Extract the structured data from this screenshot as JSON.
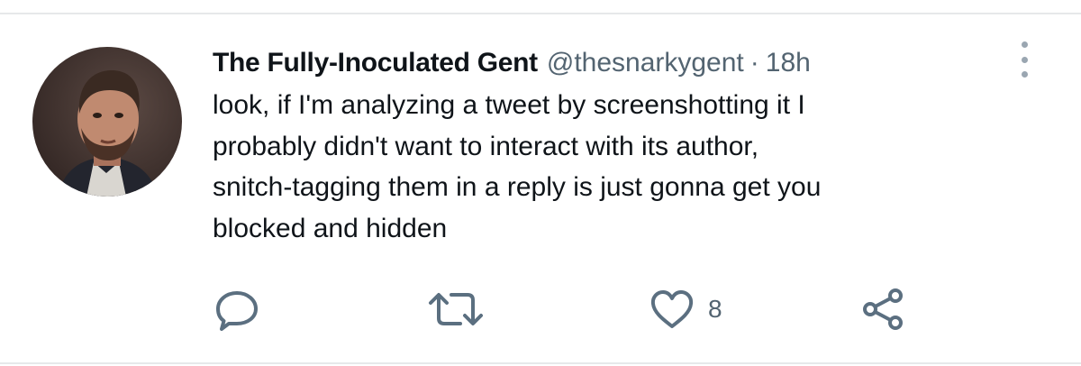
{
  "tweet": {
    "display_name": "The Fully-Inoculated Gent",
    "handle": "@thesnarkygent",
    "separator": "·",
    "time": "18h",
    "text_lines": [
      "look, if I'm analyzing a tweet by screenshotting it I",
      "probably didn't want to interact with its author,",
      "snitch-tagging them in a reply is just gonna get you",
      "blocked and hidden"
    ]
  },
  "actions": {
    "reply": {
      "icon": "reply-icon"
    },
    "retweet": {
      "icon": "retweet-icon"
    },
    "like": {
      "icon": "heart-icon",
      "count": "8"
    },
    "share": {
      "icon": "share-icon"
    }
  },
  "colors": {
    "text": "#0f1419",
    "secondary": "#536471",
    "icon": "#5b6f80",
    "divider": "#e6e8ea"
  }
}
